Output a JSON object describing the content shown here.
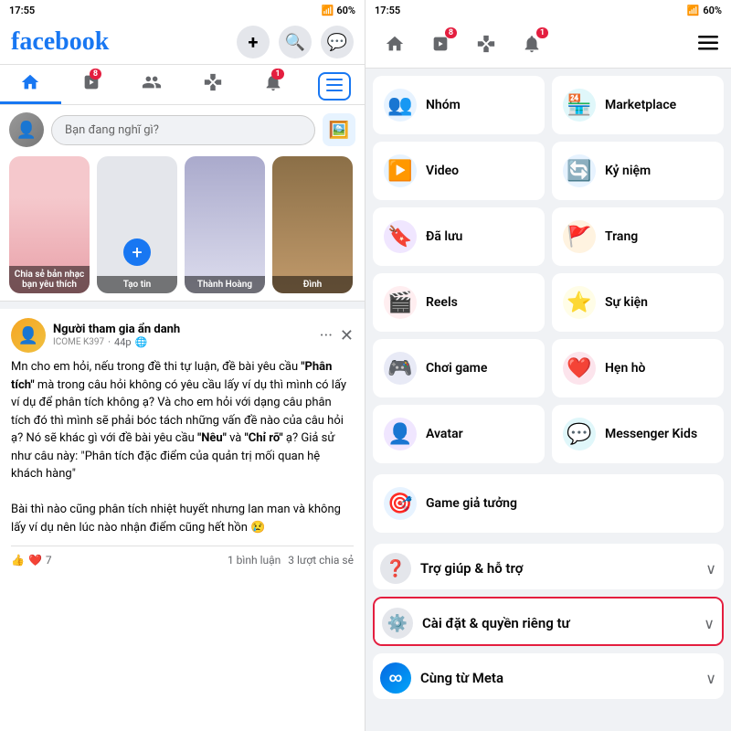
{
  "left": {
    "status_bar": {
      "time": "17:55",
      "battery": "60%"
    },
    "logo": "facebook",
    "header_icons": {
      "plus": "+",
      "search": "🔍",
      "messenger": "💬"
    },
    "nav": {
      "items": [
        {
          "id": "home",
          "active": true
        },
        {
          "id": "watch",
          "badge": "8"
        },
        {
          "id": "friends"
        },
        {
          "id": "gaming"
        },
        {
          "id": "notifications",
          "badge": "1"
        },
        {
          "id": "menu",
          "active_highlight": true
        }
      ]
    },
    "post_box": {
      "placeholder": "Bạn đang nghĩ gì?"
    },
    "stories": [
      {
        "label": "Chia sẻ bản nhạc bạn yêu thích",
        "type": "music"
      },
      {
        "label": "Tạo tin",
        "type": "create"
      },
      {
        "label": "Thành Hoàng",
        "type": "person"
      },
      {
        "label": "Đình",
        "type": "person2"
      }
    ],
    "post": {
      "author": "Người tham gia ẩn danh",
      "time": "44p",
      "privacy": "🌐",
      "group_label": "ICOME K397",
      "text_parts": [
        "Mn cho em hỏi, nếu trong đề thi tự luận, đề bài yêu cầu ",
        "\"Phân tích\"",
        " mà trong câu hỏi không có yêu cầu lấy ví dụ thì mình có lấy ví dụ để phân tích không ạ? Và cho em hỏi với dạng câu phân tích đó thì mình sẽ phải bóc tách những vấn đề nào của câu hỏi ạ? Nó sẽ khác gì với đề bài yêu cầu ",
        "\"Nêu\"",
        " và ",
        "\"Chỉ rõ\"",
        " ạ? Giả sử như câu này: \"Phân tích đặc điểm của quản trị mối quan hệ khách hàng\"\n\nBài thì nào cũng phân tích nhiệt huyết nhưng lan man và không lấy ví dụ nên lúc nào nhận điểm cũng hết hồn 😢"
      ],
      "reactions": "👍❤️",
      "reaction_count": "7",
      "comments": "1 bình luận",
      "shares": "3 lượt chia sẻ"
    }
  },
  "right": {
    "status_bar": {
      "time": "17:55",
      "battery": "60%"
    },
    "nav_icons": [
      {
        "id": "home"
      },
      {
        "id": "watch",
        "badge": "8"
      },
      {
        "id": "gaming"
      },
      {
        "id": "notifications",
        "badge": "1"
      },
      {
        "id": "menu"
      }
    ],
    "menu_items": [
      {
        "id": "nhom",
        "label": "Nhóm",
        "icon": "👥",
        "bg": "bg-blue"
      },
      {
        "id": "marketplace",
        "label": "Marketplace",
        "icon": "🏪",
        "bg": "bg-teal"
      },
      {
        "id": "video",
        "label": "Video",
        "icon": "▶️",
        "bg": "bg-blue"
      },
      {
        "id": "ky-niem",
        "label": "Kỷ niệm",
        "icon": "🔄",
        "bg": "bg-blue"
      },
      {
        "id": "da-luu",
        "label": "Đã lưu",
        "icon": "🔖",
        "bg": "bg-purple"
      },
      {
        "id": "trang",
        "label": "Trang",
        "icon": "🚩",
        "bg": "bg-orange"
      },
      {
        "id": "reels",
        "label": "Reels",
        "icon": "🎬",
        "bg": "bg-red"
      },
      {
        "id": "su-kien",
        "label": "Sự kiện",
        "icon": "⭐",
        "bg": "bg-yellow"
      },
      {
        "id": "choi-game",
        "label": "Chơi game",
        "icon": "🎮",
        "bg": "bg-indigo"
      },
      {
        "id": "hen-ho",
        "label": "Hẹn hò",
        "icon": "❤️",
        "bg": "bg-pink"
      },
      {
        "id": "avatar",
        "label": "Avatar",
        "icon": "👤",
        "bg": "bg-purple"
      },
      {
        "id": "messenger-kids",
        "label": "Messenger Kids",
        "icon": "💬",
        "bg": "bg-teal"
      },
      {
        "id": "game-gia-tuong",
        "label": "Game giả tưởng",
        "icon": "🎯",
        "bg": "bg-blue"
      }
    ],
    "sections": [
      {
        "id": "tro-giup",
        "label": "Trợ giúp & hỗ trợ",
        "icon": "❓"
      },
      {
        "id": "cai-dat",
        "label": "Cài đặt & quyền riêng tư",
        "icon": "⚙️",
        "highlighted": true
      },
      {
        "id": "cung-tu-meta",
        "label": "Cùng từ Meta",
        "icon": "∞"
      }
    ]
  }
}
